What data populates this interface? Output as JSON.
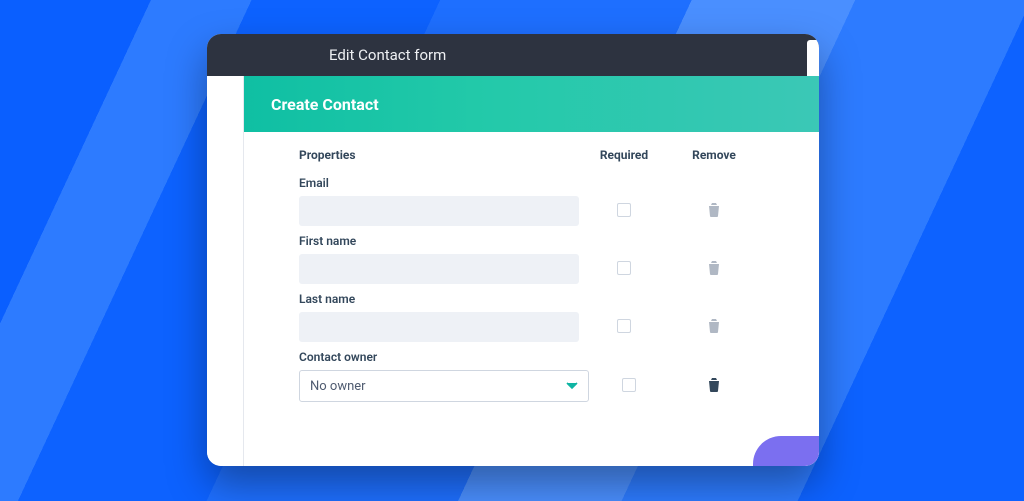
{
  "titlebar": {
    "title": "Edit Contact form"
  },
  "banner": {
    "title": "Create Contact"
  },
  "columns": {
    "properties": "Properties",
    "required": "Required",
    "remove": "Remove"
  },
  "props": {
    "email": {
      "label": "Email"
    },
    "first_name": {
      "label": "First name"
    },
    "last_name": {
      "label": "Last name"
    },
    "contact_owner": {
      "label": "Contact owner",
      "value": "No owner"
    }
  }
}
